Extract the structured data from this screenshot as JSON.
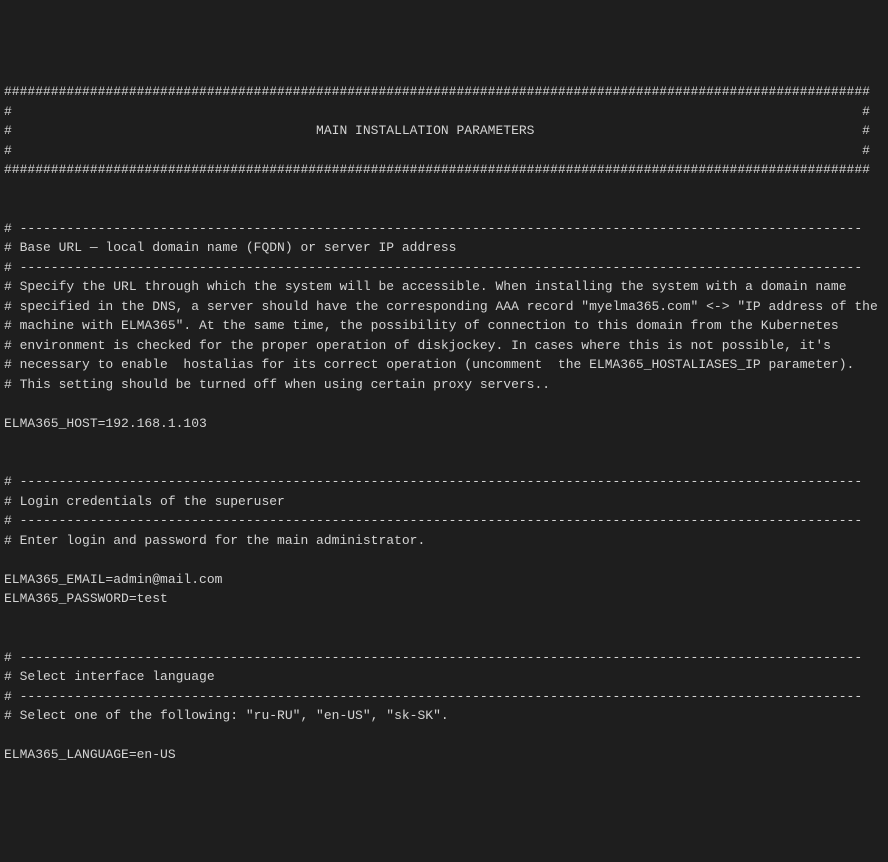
{
  "header": {
    "border_line": "###############################################################################################################",
    "empty_line": "#                                                                                                             #",
    "title_line": "#                                       MAIN INSTALLATION PARAMETERS                                          #"
  },
  "section1": {
    "separator": "# ------------------------------------------------------------------------------------------------------------",
    "title": "# Base URL — local domain name (FQDN) or server IP address",
    "desc1": "# Specify the URL through which the system will be accessible. When installing the system with a domain name",
    "desc2": "# specified in the DNS, a server should have the corresponding AAA record \"myelma365.com\" <-> \"IP address of the",
    "desc3": "# machine with ELMA365\". At the same time, the possibility of connection to this domain from the Kubernetes",
    "desc4": "# environment is checked for the proper operation of diskjockey. In cases where this is not possible, it's",
    "desc5": "# necessary to enable  hostalias for its correct operation (uncomment  the ELMA365_HOSTALIASES_IP parameter).",
    "desc6": "# This setting should be turned off when using certain proxy servers..",
    "setting": "ELMA365_HOST=192.168.1.103"
  },
  "section2": {
    "separator": "# ------------------------------------------------------------------------------------------------------------",
    "title": "# Login credentials of the superuser",
    "desc1": "# Enter login and password for the main administrator.",
    "setting1": "ELMA365_EMAIL=admin@mail.com",
    "setting2": "ELMA365_PASSWORD=test"
  },
  "section3": {
    "separator": "# ------------------------------------------------------------------------------------------------------------",
    "title": "# Select interface language",
    "desc1": "# Select one of the following: \"ru-RU\", \"en-US\", \"sk-SK\".",
    "setting": "ELMA365_LANGUAGE=en-US"
  }
}
